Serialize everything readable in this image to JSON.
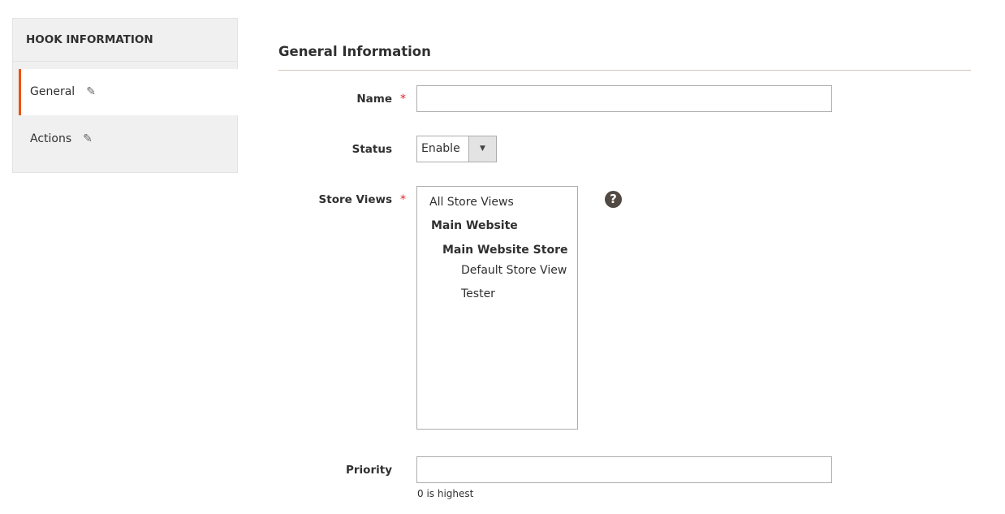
{
  "sidebar": {
    "title": "HOOK INFORMATION",
    "items": [
      {
        "label": "General",
        "active": true,
        "icon": "pencil-icon"
      },
      {
        "label": "Actions",
        "active": false,
        "icon": "pencil-icon"
      }
    ]
  },
  "section": {
    "title": "General Information"
  },
  "form": {
    "name": {
      "label": "Name",
      "required": true,
      "value": ""
    },
    "status": {
      "label": "Status",
      "value": "Enable"
    },
    "store_views": {
      "label": "Store Views",
      "required": true,
      "options": {
        "all": "All Store Views",
        "website": "Main Website",
        "store": "Main Website Store",
        "default": "Default Store View",
        "tester": "Tester"
      }
    },
    "priority": {
      "label": "Priority",
      "value": "",
      "note": "0 is highest"
    }
  },
  "colors": {
    "accent": "#eb5202",
    "required": "#e22626"
  }
}
